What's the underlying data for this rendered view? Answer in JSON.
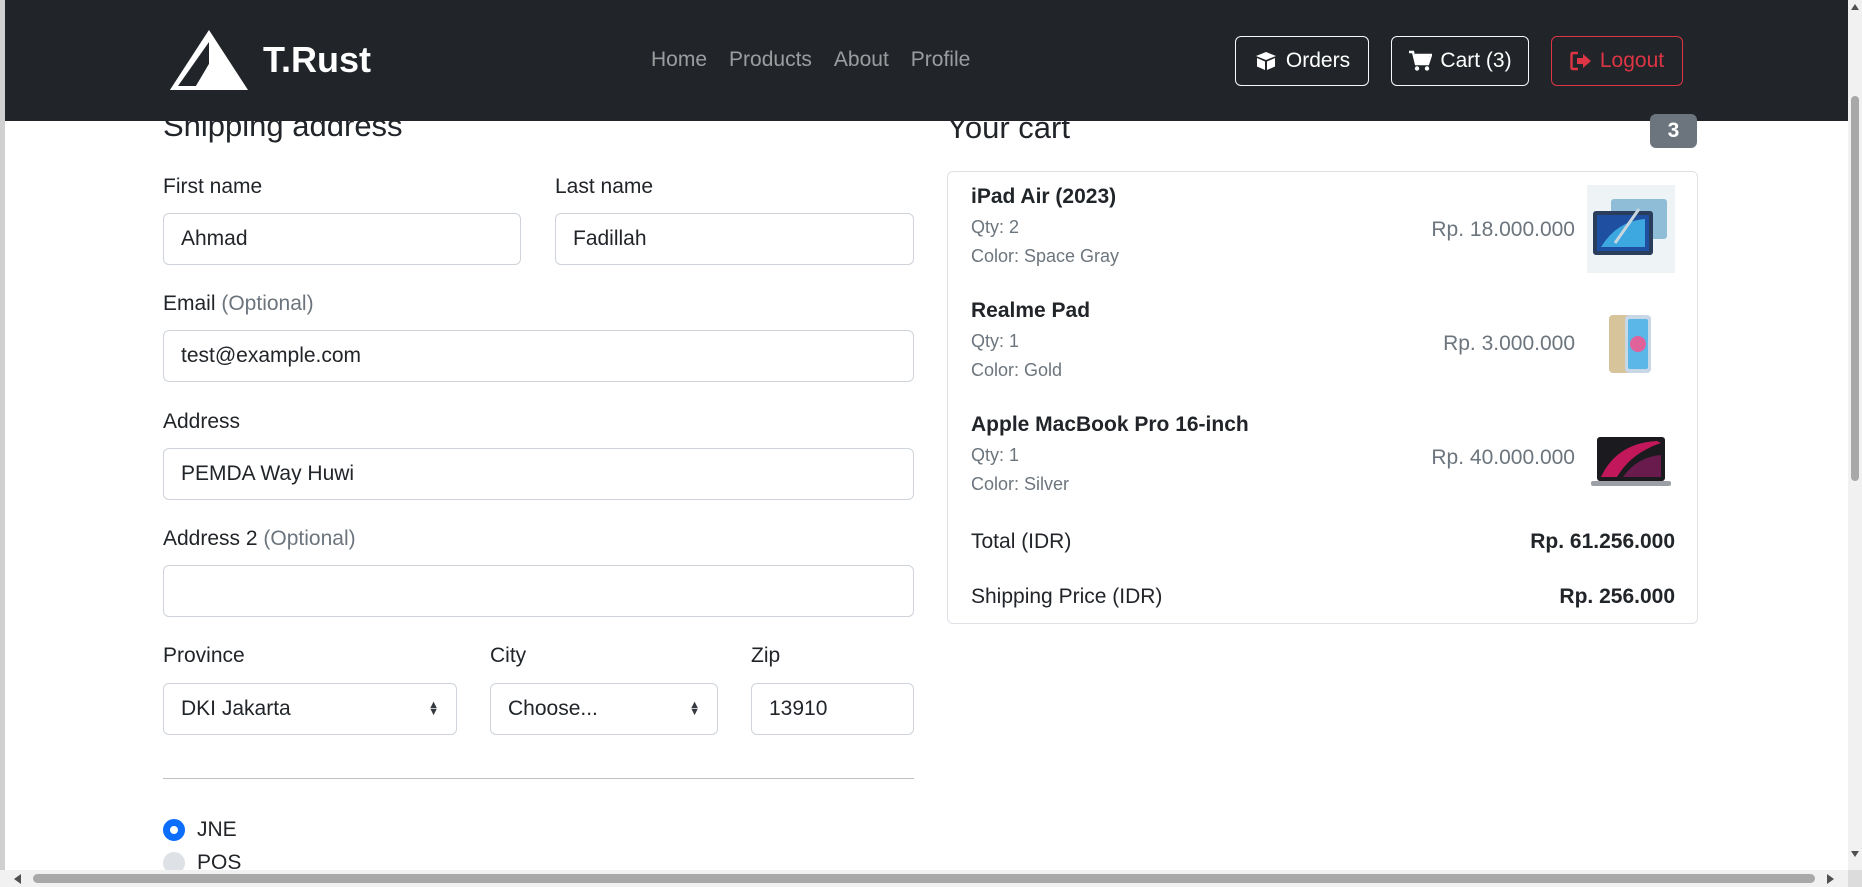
{
  "navbar": {
    "brand": "T.Rust",
    "links": [
      "Home",
      "Products",
      "About",
      "Profile"
    ],
    "orders_label": "Orders",
    "cart_label": "Cart (3)",
    "logout_label": "Logout",
    "logout_color": "#dc3545"
  },
  "shipping": {
    "title": "Shipping address",
    "first_name": {
      "label": "First name",
      "value": "Ahmad"
    },
    "last_name": {
      "label": "Last name",
      "value": "Fadillah"
    },
    "email": {
      "label": "Email",
      "optional": "(Optional)",
      "value": "test@example.com"
    },
    "address": {
      "label": "Address",
      "value": "PEMDA Way Huwi"
    },
    "address2": {
      "label": "Address 2",
      "optional": "(Optional)",
      "value": ""
    },
    "province": {
      "label": "Province",
      "value": "DKI Jakarta"
    },
    "city": {
      "label": "City",
      "value": "Choose..."
    },
    "zip": {
      "label": "Zip",
      "value": "13910"
    },
    "couriers": [
      {
        "label": "JNE",
        "checked": true
      },
      {
        "label": "POS",
        "checked": false
      }
    ]
  },
  "cart": {
    "title": "Your cart",
    "count": "3",
    "items": [
      {
        "name": "iPad Air (2023)",
        "qty": "Qty: 2",
        "color": "Color: Space Gray",
        "price": "Rp. 18.000.000",
        "icon": "ipad-image"
      },
      {
        "name": "Realme Pad",
        "qty": "Qty: 1",
        "color": "Color: Gold",
        "price": "Rp. 3.000.000",
        "icon": "tablet-image"
      },
      {
        "name": "Apple MacBook Pro 16-inch",
        "qty": "Qty: 1",
        "color": "Color: Silver",
        "price": "Rp. 40.000.000",
        "icon": "laptop-image"
      }
    ],
    "total_label": "Total (IDR)",
    "total_value": "Rp. 61.256.000",
    "shipping_label": "Shipping Price (IDR)",
    "shipping_value": "Rp. 256.000"
  }
}
